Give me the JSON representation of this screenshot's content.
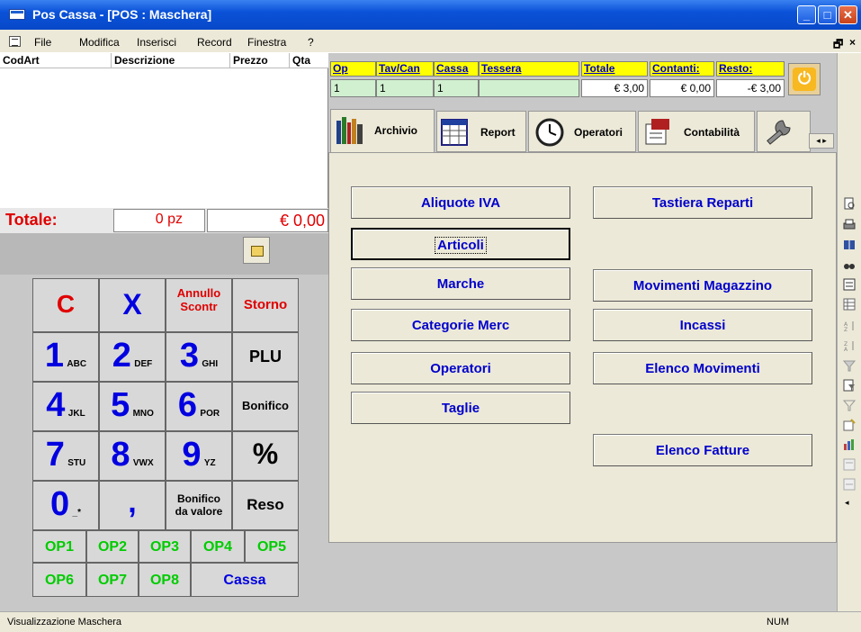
{
  "window": {
    "title": "Pos Cassa - [POS : Maschera]"
  },
  "menu": [
    "File",
    "Modifica",
    "Inserisci",
    "Record",
    "Finestra",
    "?"
  ],
  "sale_list": {
    "headers": [
      "CodArt",
      "Descrizione",
      "Prezzo",
      "Qta"
    ]
  },
  "totals": {
    "label": "Totale:",
    "pieces": "0 pz",
    "amount": "€ 0,00"
  },
  "info_grid": {
    "headers": [
      "Op",
      "Tav/Can",
      "Cassa",
      "Tessera",
      "Totale",
      "Contanti:",
      "Resto:"
    ],
    "values": [
      "1",
      "1",
      "1",
      "",
      "€ 3,00",
      "€ 0,00",
      "-€ 3,00"
    ]
  },
  "tabs": [
    "Archivio",
    "Report",
    "Operatori",
    "Contabilità"
  ],
  "panel_buttons": {
    "left": [
      "Aliquote IVA",
      "Articoli",
      "Marche",
      "Categorie Merc",
      "Operatori",
      "Taglie"
    ],
    "right": [
      "Tastiera Reparti",
      "Movimenti Magazzino",
      "Incassi",
      "Elenco Movimenti",
      "Elenco Fatture"
    ]
  },
  "keypad": {
    "C": "C",
    "X": "X",
    "annullo1": "Annullo",
    "annullo2": "Scontr",
    "storno": "Storno",
    "n1": "1",
    "s1": "ABC",
    "n2": "2",
    "s2": "DEF",
    "n3": "3",
    "s3": "GHI",
    "plu": "PLU",
    "n4": "4",
    "s4": "JKL",
    "n5": "5",
    "s5": "MNO",
    "n6": "6",
    "s6": "POR",
    "bonifico": "Bonifico",
    "n7": "7",
    "s7": "STU",
    "n8": "8",
    "s8": "VWX",
    "n9": "9",
    "s9": "YZ",
    "percent": "%",
    "n0": "0",
    "s0": "_*",
    "comma": ",",
    "bonval1": "Bonifico",
    "bonval2": "da valore",
    "reso": "Reso",
    "op": [
      "OP1",
      "OP2",
      "OP3",
      "OP4",
      "OP5",
      "OP6",
      "OP7",
      "OP8"
    ],
    "cassa": "Cassa"
  },
  "status": {
    "left": "Visualizzazione Maschera",
    "right": "NUM"
  }
}
